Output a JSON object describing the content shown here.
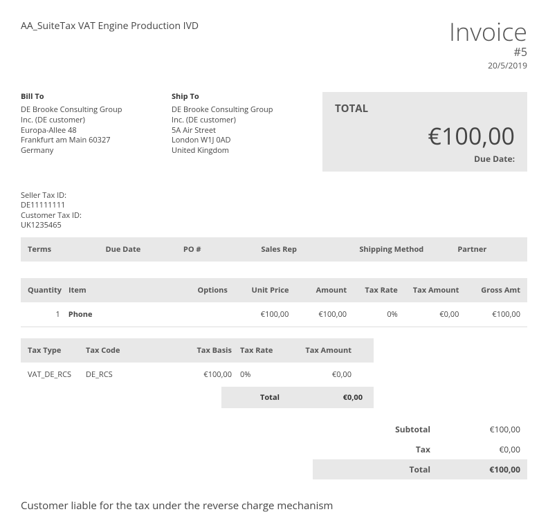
{
  "header": {
    "company": "AA_SuiteTax VAT Engine Production IVD",
    "title": "Invoice",
    "number": "#5",
    "date": "20/5/2019"
  },
  "bill_to": {
    "label": "Bill To",
    "lines": [
      "DE Brooke Consulting Group",
      "Inc. (DE customer)",
      "Europa-Allee 48",
      "Frankfurt am Main 60327",
      "Germany"
    ]
  },
  "ship_to": {
    "label": "Ship To",
    "lines": [
      "DE Brooke Consulting Group",
      "Inc. (DE customer)",
      "5A Air Street",
      "London W1J 0AD",
      "United Kingdom"
    ]
  },
  "total_box": {
    "label": "TOTAL",
    "amount": "€100,00",
    "due_label": "Due Date:"
  },
  "tax_ids": {
    "seller_label": "Seller Tax ID:",
    "seller_value": "DE11111111",
    "customer_label": "Customer Tax ID:",
    "customer_value": "UK1235465"
  },
  "meta_headers": {
    "terms": "Terms",
    "due_date": "Due Date",
    "po": "PO #",
    "sales_rep": "Sales Rep",
    "shipping": "Shipping Method",
    "partner": "Partner"
  },
  "meta_values": {
    "terms": "",
    "due_date": "",
    "po": "",
    "sales_rep": "",
    "shipping": "",
    "partner": ""
  },
  "line_headers": {
    "qty": "Quantity",
    "item": "Item",
    "options": "Options",
    "unit_price": "Unit Price",
    "amount": "Amount",
    "tax_rate": "Tax Rate",
    "tax_amount": "Tax Amount",
    "gross": "Gross Amt"
  },
  "line_items": [
    {
      "qty": "1",
      "item": "Phone",
      "options": "",
      "unit_price": "€100,00",
      "amount": "€100,00",
      "tax_rate": "0%",
      "tax_amount": "€0,00",
      "gross": "€100,00"
    }
  ],
  "tax_headers": {
    "type": "Tax Type",
    "code": "Tax Code",
    "basis": "Tax Basis",
    "rate": "Tax Rate",
    "amount": "Tax Amount"
  },
  "tax_rows": [
    {
      "type": "VAT_DE_RCS",
      "code": "DE_RCS",
      "basis": "€100,00",
      "rate": "0%",
      "amount": "€0,00"
    }
  ],
  "tax_total": {
    "label": "Total",
    "amount": "€0,00"
  },
  "totals": {
    "subtotal_label": "Subtotal",
    "subtotal_value": "€100,00",
    "tax_label": "Tax",
    "tax_value": "€0,00",
    "total_label": "Total",
    "total_value": "€100,00"
  },
  "footer_note": "Customer liable for the tax under the reverse charge mechanism"
}
